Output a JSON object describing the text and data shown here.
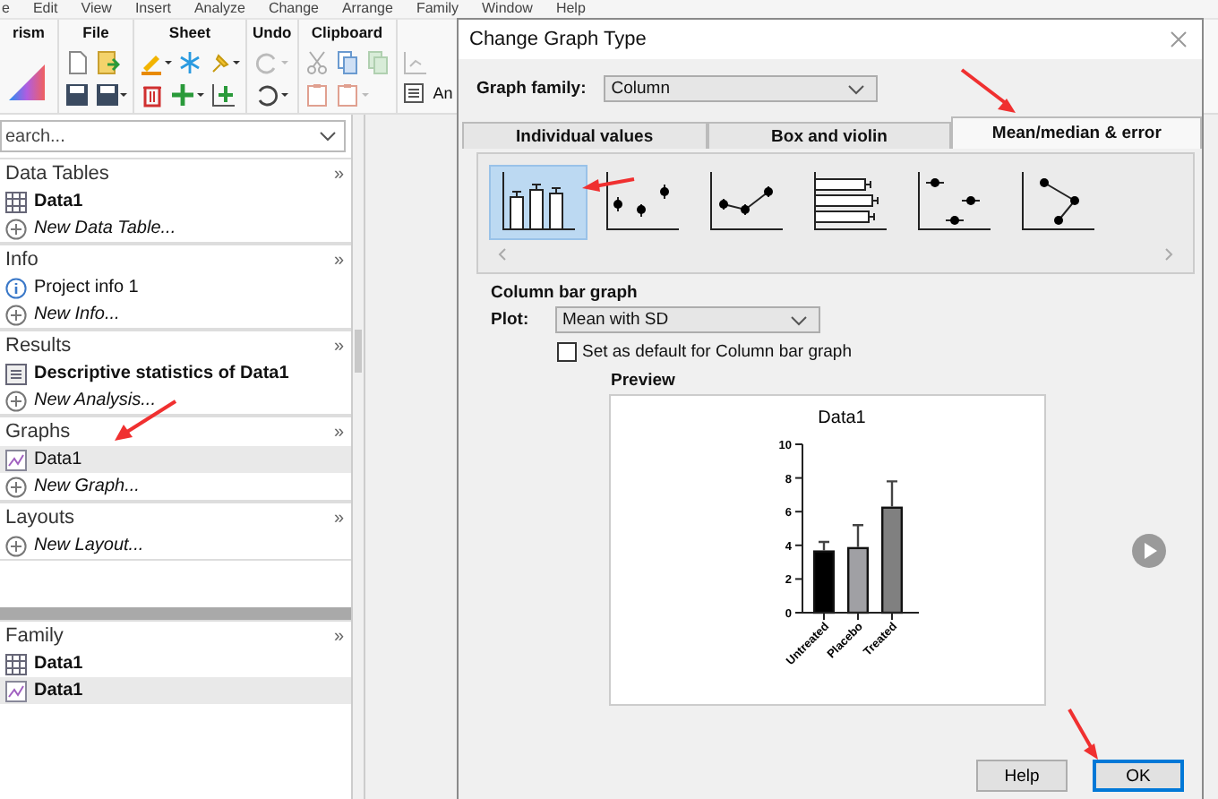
{
  "menu": [
    "e",
    "Edit",
    "View",
    "Insert",
    "Analyze",
    "Change",
    "Arrange",
    "Family",
    "Window",
    "Help"
  ],
  "ribbon": {
    "groups": [
      {
        "label": "rism"
      },
      {
        "label": "File"
      },
      {
        "label": "Sheet"
      },
      {
        "label": "Undo"
      },
      {
        "label": "Clipboard"
      }
    ],
    "extra_label": "An"
  },
  "navigator": {
    "search": {
      "placeholder": "earch..."
    },
    "sections": [
      {
        "title": "Data Tables",
        "more": "»",
        "items": [
          {
            "kind": "table",
            "label": "Data1",
            "bold": true,
            "selected": false
          },
          {
            "kind": "new",
            "label": "New Data Table...",
            "bold": false,
            "selected": false
          }
        ]
      },
      {
        "title": "Info",
        "more": "»",
        "items": [
          {
            "kind": "info",
            "label": "Project info 1",
            "bold": false,
            "selected": false
          },
          {
            "kind": "new",
            "label": "New Info...",
            "bold": false,
            "selected": false
          }
        ]
      },
      {
        "title": "Results",
        "more": "»",
        "items": [
          {
            "kind": "results",
            "label": "Descriptive statistics of Data1",
            "bold": true,
            "selected": false
          },
          {
            "kind": "new",
            "label": "New Analysis...",
            "bold": false,
            "selected": false
          }
        ]
      },
      {
        "title": "Graphs",
        "more": "»",
        "items": [
          {
            "kind": "graph",
            "label": "Data1",
            "bold": false,
            "selected": true
          },
          {
            "kind": "new",
            "label": "New Graph...",
            "bold": false,
            "selected": false
          }
        ]
      },
      {
        "title": "Layouts",
        "more": "»",
        "items": [
          {
            "kind": "new",
            "label": "New Layout...",
            "bold": false,
            "selected": false
          }
        ]
      }
    ],
    "family": {
      "title": "Family",
      "more": "»",
      "items": [
        {
          "kind": "table",
          "label": "Data1",
          "bold": true,
          "selected": false
        },
        {
          "kind": "graph",
          "label": "Data1",
          "bold": true,
          "selected": true
        }
      ]
    }
  },
  "dialog": {
    "title": "Change Graph Type",
    "graph_family": {
      "label": "Graph family:",
      "value": "Column"
    },
    "tabs": [
      {
        "label": "Individual values",
        "selected": false
      },
      {
        "label": "Box and violin",
        "selected": false
      },
      {
        "label": "Mean/median & error",
        "selected": true
      }
    ],
    "gallery": [
      {
        "kind": "column-bars",
        "selected": true
      },
      {
        "kind": "points",
        "selected": false
      },
      {
        "kind": "line",
        "selected": false
      },
      {
        "kind": "horizontal-bars",
        "selected": false
      },
      {
        "kind": "scatter",
        "selected": false
      },
      {
        "kind": "connected",
        "selected": false
      }
    ],
    "graph_name": "Column bar graph",
    "plot": {
      "label": "Plot:",
      "value": "Mean with SD"
    },
    "default_checkbox": {
      "label": "Set as default for Column bar graph",
      "checked": false
    },
    "preview": {
      "label": "Preview",
      "chart_data": {
        "type": "bar",
        "title": "Data1",
        "categories": [
          "Untreated",
          "Placebo",
          "Treated"
        ],
        "series": [
          {
            "color": "#000000",
            "values": [
              3.7,
              null,
              null
            ]
          },
          {
            "color": "#a0a0a4",
            "values": [
              null,
              3.9,
              null
            ]
          },
          {
            "color": "#808080",
            "values": [
              null,
              null,
              6.3
            ]
          }
        ],
        "stacked": true,
        "ylim": [
          0,
          10
        ],
        "yticks": [
          0,
          2,
          4,
          6,
          8,
          10
        ]
      }
    },
    "buttons": [
      {
        "label": "Help",
        "default": false
      },
      {
        "label": "OK",
        "default": true
      }
    ]
  }
}
